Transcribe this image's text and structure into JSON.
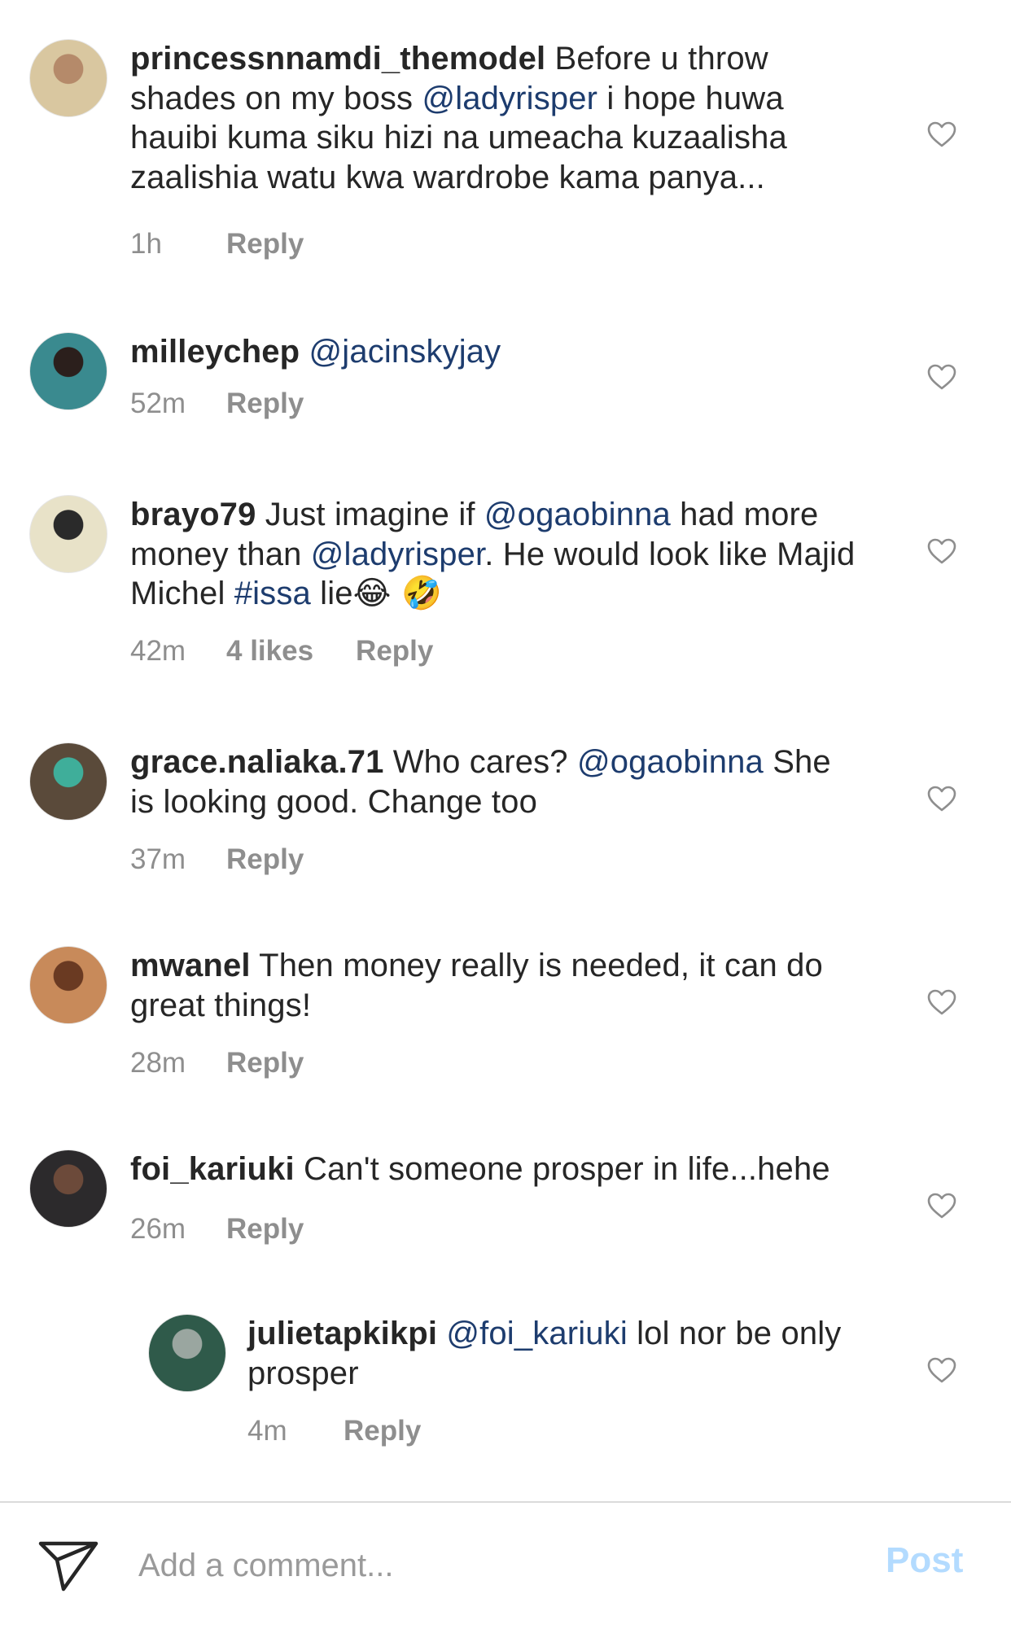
{
  "comments": [
    {
      "username": "princessnnamdi_themodel",
      "segments": [
        {
          "t": " Before u throw shades on my boss  "
        },
        {
          "t": "@ladyrisper",
          "m": true
        },
        {
          "t": "  i hope huwa hauibi kuma siku hizi na umeacha kuzaalisha zaalishia watu kwa wardrobe kama panya..."
        }
      ],
      "time": "1h",
      "likes": "",
      "reply": "Reply",
      "avatar_colors": [
        "#d9c7a0",
        "#b58a6a"
      ]
    },
    {
      "username": "milleychep",
      "segments": [
        {
          "t": " "
        },
        {
          "t": "@jacinskyjay",
          "m": true
        }
      ],
      "time": "52m",
      "likes": "",
      "reply": "Reply",
      "avatar_colors": [
        "#3a8a8f",
        "#2b1f1c"
      ]
    },
    {
      "username": "brayo79",
      "segments": [
        {
          "t": " Just imagine if "
        },
        {
          "t": "@ogaobinna",
          "m": true
        },
        {
          "t": " had more money than "
        },
        {
          "t": "@ladyrisper",
          "m": true
        },
        {
          "t": ". He would look like Majid Michel "
        },
        {
          "t": "#issa",
          "m": true
        },
        {
          "t": " lie"
        },
        {
          "t": "😂 🤣",
          "e": true
        }
      ],
      "time": "42m",
      "likes": "4 likes",
      "reply": "Reply",
      "avatar_colors": [
        "#e8e2c8",
        "#2a2a2a"
      ]
    },
    {
      "username": "grace.naliaka.71",
      "segments": [
        {
          "t": " Who cares? "
        },
        {
          "t": "@ogaobinna",
          "m": true
        },
        {
          "t": " She is looking good. Change too"
        }
      ],
      "time": "37m",
      "likes": "",
      "reply": "Reply",
      "avatar_colors": [
        "#5a4a3a",
        "#3fae9a"
      ]
    },
    {
      "username": "mwanel",
      "segments": [
        {
          "t": " Then money really is needed, it can do great things!"
        }
      ],
      "time": "28m",
      "likes": "",
      "reply": "Reply",
      "avatar_colors": [
        "#c88a5a",
        "#6a3a22"
      ]
    },
    {
      "username": "foi_kariuki",
      "segments": [
        {
          "t": " Can't someone prosper in life...hehe"
        }
      ],
      "time": "26m",
      "likes": "",
      "reply": "Reply",
      "avatar_colors": [
        "#2c2a2c",
        "#6c4a3a"
      ]
    },
    {
      "username": "julietapkikpi",
      "segments": [
        {
          "t": " "
        },
        {
          "t": "@foi_kariuki",
          "m": true
        },
        {
          "t": " lol nor be only prosper"
        }
      ],
      "time": "4m",
      "likes": "",
      "reply": "Reply",
      "avatar_colors": [
        "#2f5a4a",
        "#9aa6a0"
      ]
    }
  ],
  "composer": {
    "placeholder": "Add a comment...",
    "post_label": "Post"
  },
  "colors": {
    "mention": "#1d3c6e",
    "meta": "#8e8e8e",
    "post_disabled": "#b3dbff"
  },
  "icons": {
    "like": "heart-icon",
    "send": "direct-send-icon"
  }
}
